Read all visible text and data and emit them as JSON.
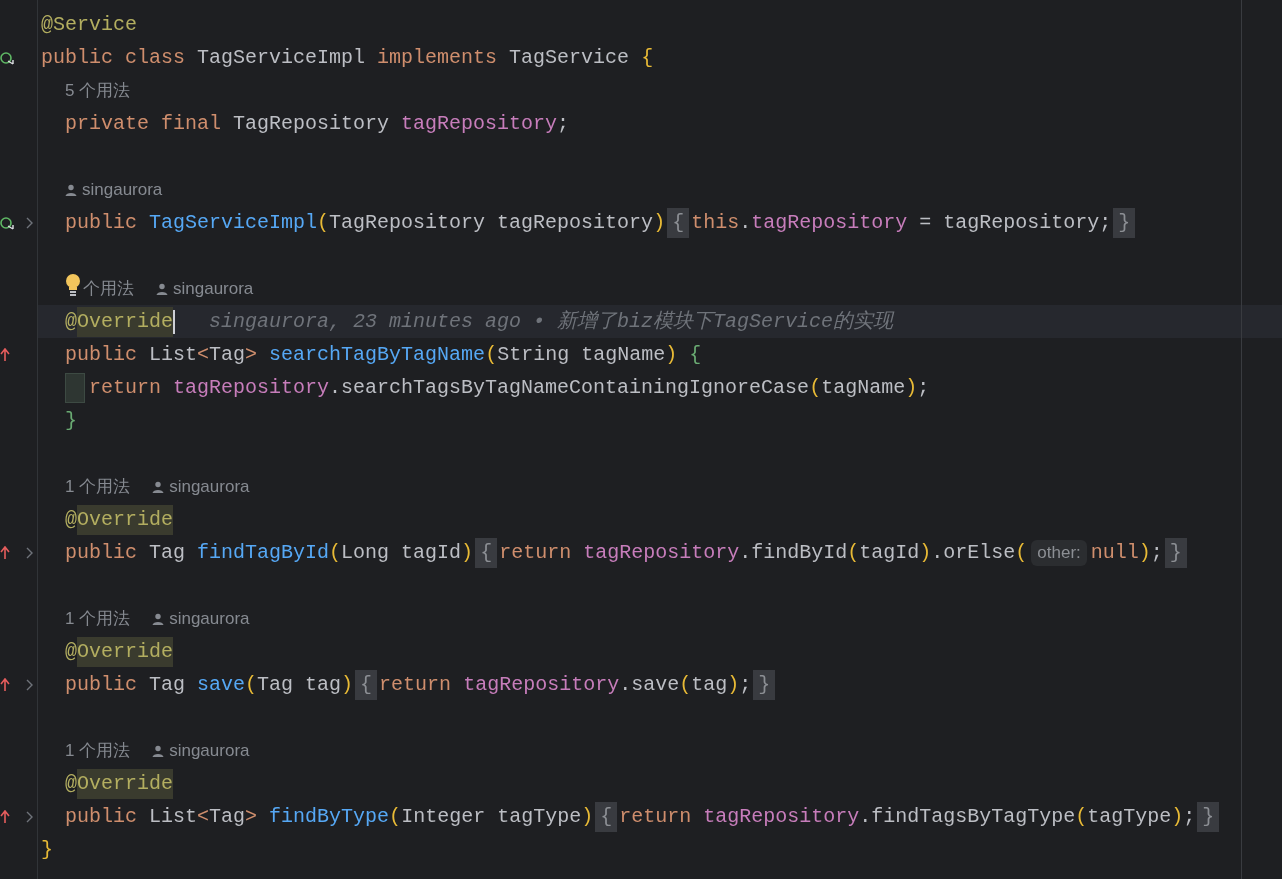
{
  "editor": {
    "lines": [
      {
        "kind": "code",
        "folded": false,
        "current": false,
        "caret": false,
        "tokens": [
          {
            "kind": "ann",
            "text": "@Service"
          }
        ]
      },
      {
        "kind": "code",
        "gutter": {
          "kind": "implemented"
        },
        "folded": false,
        "current": false,
        "caret": false,
        "tokens": [
          {
            "kind": "kw",
            "text": "public class "
          },
          {
            "kind": "plain",
            "text": "TagServiceImpl "
          },
          {
            "kind": "kw",
            "text": "implements "
          },
          {
            "kind": "plain",
            "text": "TagService "
          },
          {
            "kind": "y",
            "text": "{"
          }
        ],
        "children": [
          {
            "kind": "hint",
            "bulb": false,
            "usages": "5 个用法"
          },
          {
            "kind": "code",
            "folded": false,
            "current": false,
            "caret": false,
            "tokens": [
              {
                "kind": "kw",
                "text": "private final "
              },
              {
                "kind": "plain",
                "text": "TagRepository "
              },
              {
                "kind": "field",
                "text": "tagRepository"
              },
              {
                "kind": "plain",
                "text": ";"
              }
            ]
          },
          {
            "kind": "blank"
          },
          {
            "kind": "hint",
            "bulb": false,
            "author": "singaurora"
          },
          {
            "kind": "code",
            "gutter": {
              "kind": "implemented"
            },
            "folded": true,
            "current": false,
            "caret": false,
            "tokens": [
              {
                "kind": "kw",
                "text": "public "
              },
              {
                "kind": "decl",
                "text": "TagServiceImpl"
              },
              {
                "kind": "y",
                "text": "("
              },
              {
                "kind": "plain",
                "text": "TagRepository tagRepository"
              },
              {
                "kind": "y",
                "text": ")"
              },
              {
                "kind": "fold",
                "text": "{"
              },
              {
                "kind": "kw",
                "text": "this"
              },
              {
                "kind": "plain",
                "text": "."
              },
              {
                "kind": "field",
                "text": "tagRepository"
              },
              {
                "kind": "plain",
                "text": " = tagRepository;"
              },
              {
                "kind": "fold",
                "text": "}"
              }
            ]
          },
          {
            "kind": "blank"
          },
          {
            "kind": "hint",
            "bulb": true,
            "usages": "个用法",
            "author": "singaurora"
          },
          {
            "kind": "code",
            "folded": false,
            "current": true,
            "caret": true,
            "blame": "singaurora, 23 minutes ago • 新增了biz模块下TagService的实现",
            "tokens": [
              {
                "kind": "ann",
                "text": "@"
              },
              {
                "kind": "annhl",
                "text": "Override"
              }
            ]
          },
          {
            "kind": "code",
            "gutter": {
              "kind": "overrides"
            },
            "folded": false,
            "current": false,
            "caret": false,
            "tokens": [
              {
                "kind": "kw",
                "text": "public "
              },
              {
                "kind": "plain",
                "text": "List"
              },
              {
                "kind": "kw",
                "text": "<"
              },
              {
                "kind": "plain",
                "text": "Tag"
              },
              {
                "kind": "kw",
                "text": "> "
              },
              {
                "kind": "decl",
                "text": "searchTagByTagName"
              },
              {
                "kind": "y",
                "text": "("
              },
              {
                "kind": "plain",
                "text": "String tagName"
              },
              {
                "kind": "y",
                "text": ") "
              },
              {
                "kind": "g",
                "text": "{"
              }
            ],
            "children": [
              {
                "kind": "code",
                "folded": false,
                "current": false,
                "caret": false,
                "indent_marker": true,
                "tokens": [
                  {
                    "kind": "kw",
                    "text": "return "
                  },
                  {
                    "kind": "field",
                    "text": "tagRepository"
                  },
                  {
                    "kind": "plain",
                    "text": ".searchTagsByTagNameContainingIgnoreCase"
                  },
                  {
                    "kind": "y",
                    "text": "("
                  },
                  {
                    "kind": "plain",
                    "text": "tagName"
                  },
                  {
                    "kind": "y",
                    "text": ")"
                  },
                  {
                    "kind": "plain",
                    "text": ";"
                  }
                ]
              }
            ]
          },
          {
            "kind": "code",
            "folded": false,
            "current": false,
            "caret": false,
            "tokens": [
              {
                "kind": "g",
                "text": "}"
              }
            ]
          },
          {
            "kind": "blank"
          },
          {
            "kind": "hint",
            "bulb": false,
            "usages": "1 个用法",
            "author": "singaurora"
          },
          {
            "kind": "code",
            "folded": false,
            "current": false,
            "caret": false,
            "tokens": [
              {
                "kind": "ann",
                "text": "@"
              },
              {
                "kind": "annhl",
                "text": "Override"
              }
            ]
          },
          {
            "kind": "code",
            "gutter": {
              "kind": "overrides"
            },
            "folded": true,
            "current": false,
            "caret": false,
            "tokens": [
              {
                "kind": "kw",
                "text": "public "
              },
              {
                "kind": "plain",
                "text": "Tag "
              },
              {
                "kind": "decl",
                "text": "findTagById"
              },
              {
                "kind": "y",
                "text": "("
              },
              {
                "kind": "plain",
                "text": "Long tagId"
              },
              {
                "kind": "y",
                "text": ")"
              },
              {
                "kind": "fold",
                "text": "{"
              },
              {
                "kind": "kw",
                "text": "return "
              },
              {
                "kind": "field",
                "text": "tagRepository"
              },
              {
                "kind": "plain",
                "text": ".findById"
              },
              {
                "kind": "y",
                "text": "("
              },
              {
                "kind": "plain",
                "text": "tagId"
              },
              {
                "kind": "y",
                "text": ")"
              },
              {
                "kind": "plain",
                "text": ".orElse"
              },
              {
                "kind": "y",
                "text": "("
              },
              {
                "kind": "inlay",
                "text": "other:"
              },
              {
                "kind": "kw",
                "text": "null"
              },
              {
                "kind": "y",
                "text": ")"
              },
              {
                "kind": "plain",
                "text": ";"
              },
              {
                "kind": "fold",
                "text": "}"
              }
            ]
          },
          {
            "kind": "blank"
          },
          {
            "kind": "hint",
            "bulb": false,
            "usages": "1 个用法",
            "author": "singaurora"
          },
          {
            "kind": "code",
            "folded": false,
            "current": false,
            "caret": false,
            "tokens": [
              {
                "kind": "ann",
                "text": "@"
              },
              {
                "kind": "annhl",
                "text": "Override"
              }
            ]
          },
          {
            "kind": "code",
            "gutter": {
              "kind": "overrides"
            },
            "folded": true,
            "current": false,
            "caret": false,
            "tokens": [
              {
                "kind": "kw",
                "text": "public "
              },
              {
                "kind": "plain",
                "text": "Tag "
              },
              {
                "kind": "decl",
                "text": "save"
              },
              {
                "kind": "y",
                "text": "("
              },
              {
                "kind": "plain",
                "text": "Tag tag"
              },
              {
                "kind": "y",
                "text": ")"
              },
              {
                "kind": "fold",
                "text": "{"
              },
              {
                "kind": "kw",
                "text": "return "
              },
              {
                "kind": "field",
                "text": "tagRepository"
              },
              {
                "kind": "plain",
                "text": ".save"
              },
              {
                "kind": "y",
                "text": "("
              },
              {
                "kind": "plain",
                "text": "tag"
              },
              {
                "kind": "y",
                "text": ")"
              },
              {
                "kind": "plain",
                "text": ";"
              },
              {
                "kind": "fold",
                "text": "}"
              }
            ]
          },
          {
            "kind": "blank"
          },
          {
            "kind": "hint",
            "bulb": false,
            "usages": "1 个用法",
            "author": "singaurora"
          },
          {
            "kind": "code",
            "folded": false,
            "current": false,
            "caret": false,
            "tokens": [
              {
                "kind": "ann",
                "text": "@"
              },
              {
                "kind": "annhl",
                "text": "Override"
              }
            ]
          },
          {
            "kind": "code",
            "gutter": {
              "kind": "overrides"
            },
            "folded": true,
            "current": false,
            "caret": false,
            "tokens": [
              {
                "kind": "kw",
                "text": "public "
              },
              {
                "kind": "plain",
                "text": "List"
              },
              {
                "kind": "kw",
                "text": "<"
              },
              {
                "kind": "plain",
                "text": "Tag"
              },
              {
                "kind": "kw",
                "text": "> "
              },
              {
                "kind": "decl",
                "text": "findByType"
              },
              {
                "kind": "y",
                "text": "("
              },
              {
                "kind": "plain",
                "text": "Integer tagType"
              },
              {
                "kind": "y",
                "text": ")"
              },
              {
                "kind": "fold",
                "text": "{"
              },
              {
                "kind": "kw",
                "text": "return "
              },
              {
                "kind": "field",
                "text": "tagRepository"
              },
              {
                "kind": "plain",
                "text": ".findTagsByTagType"
              },
              {
                "kind": "y",
                "text": "("
              },
              {
                "kind": "plain",
                "text": "tagType"
              },
              {
                "kind": "y",
                "text": ")"
              },
              {
                "kind": "plain",
                "text": ";"
              },
              {
                "kind": "fold",
                "text": "}"
              }
            ]
          }
        ]
      },
      {
        "kind": "code",
        "folded": false,
        "current": false,
        "caret": false,
        "tokens": [
          {
            "kind": "y",
            "text": "}"
          }
        ]
      }
    ]
  }
}
